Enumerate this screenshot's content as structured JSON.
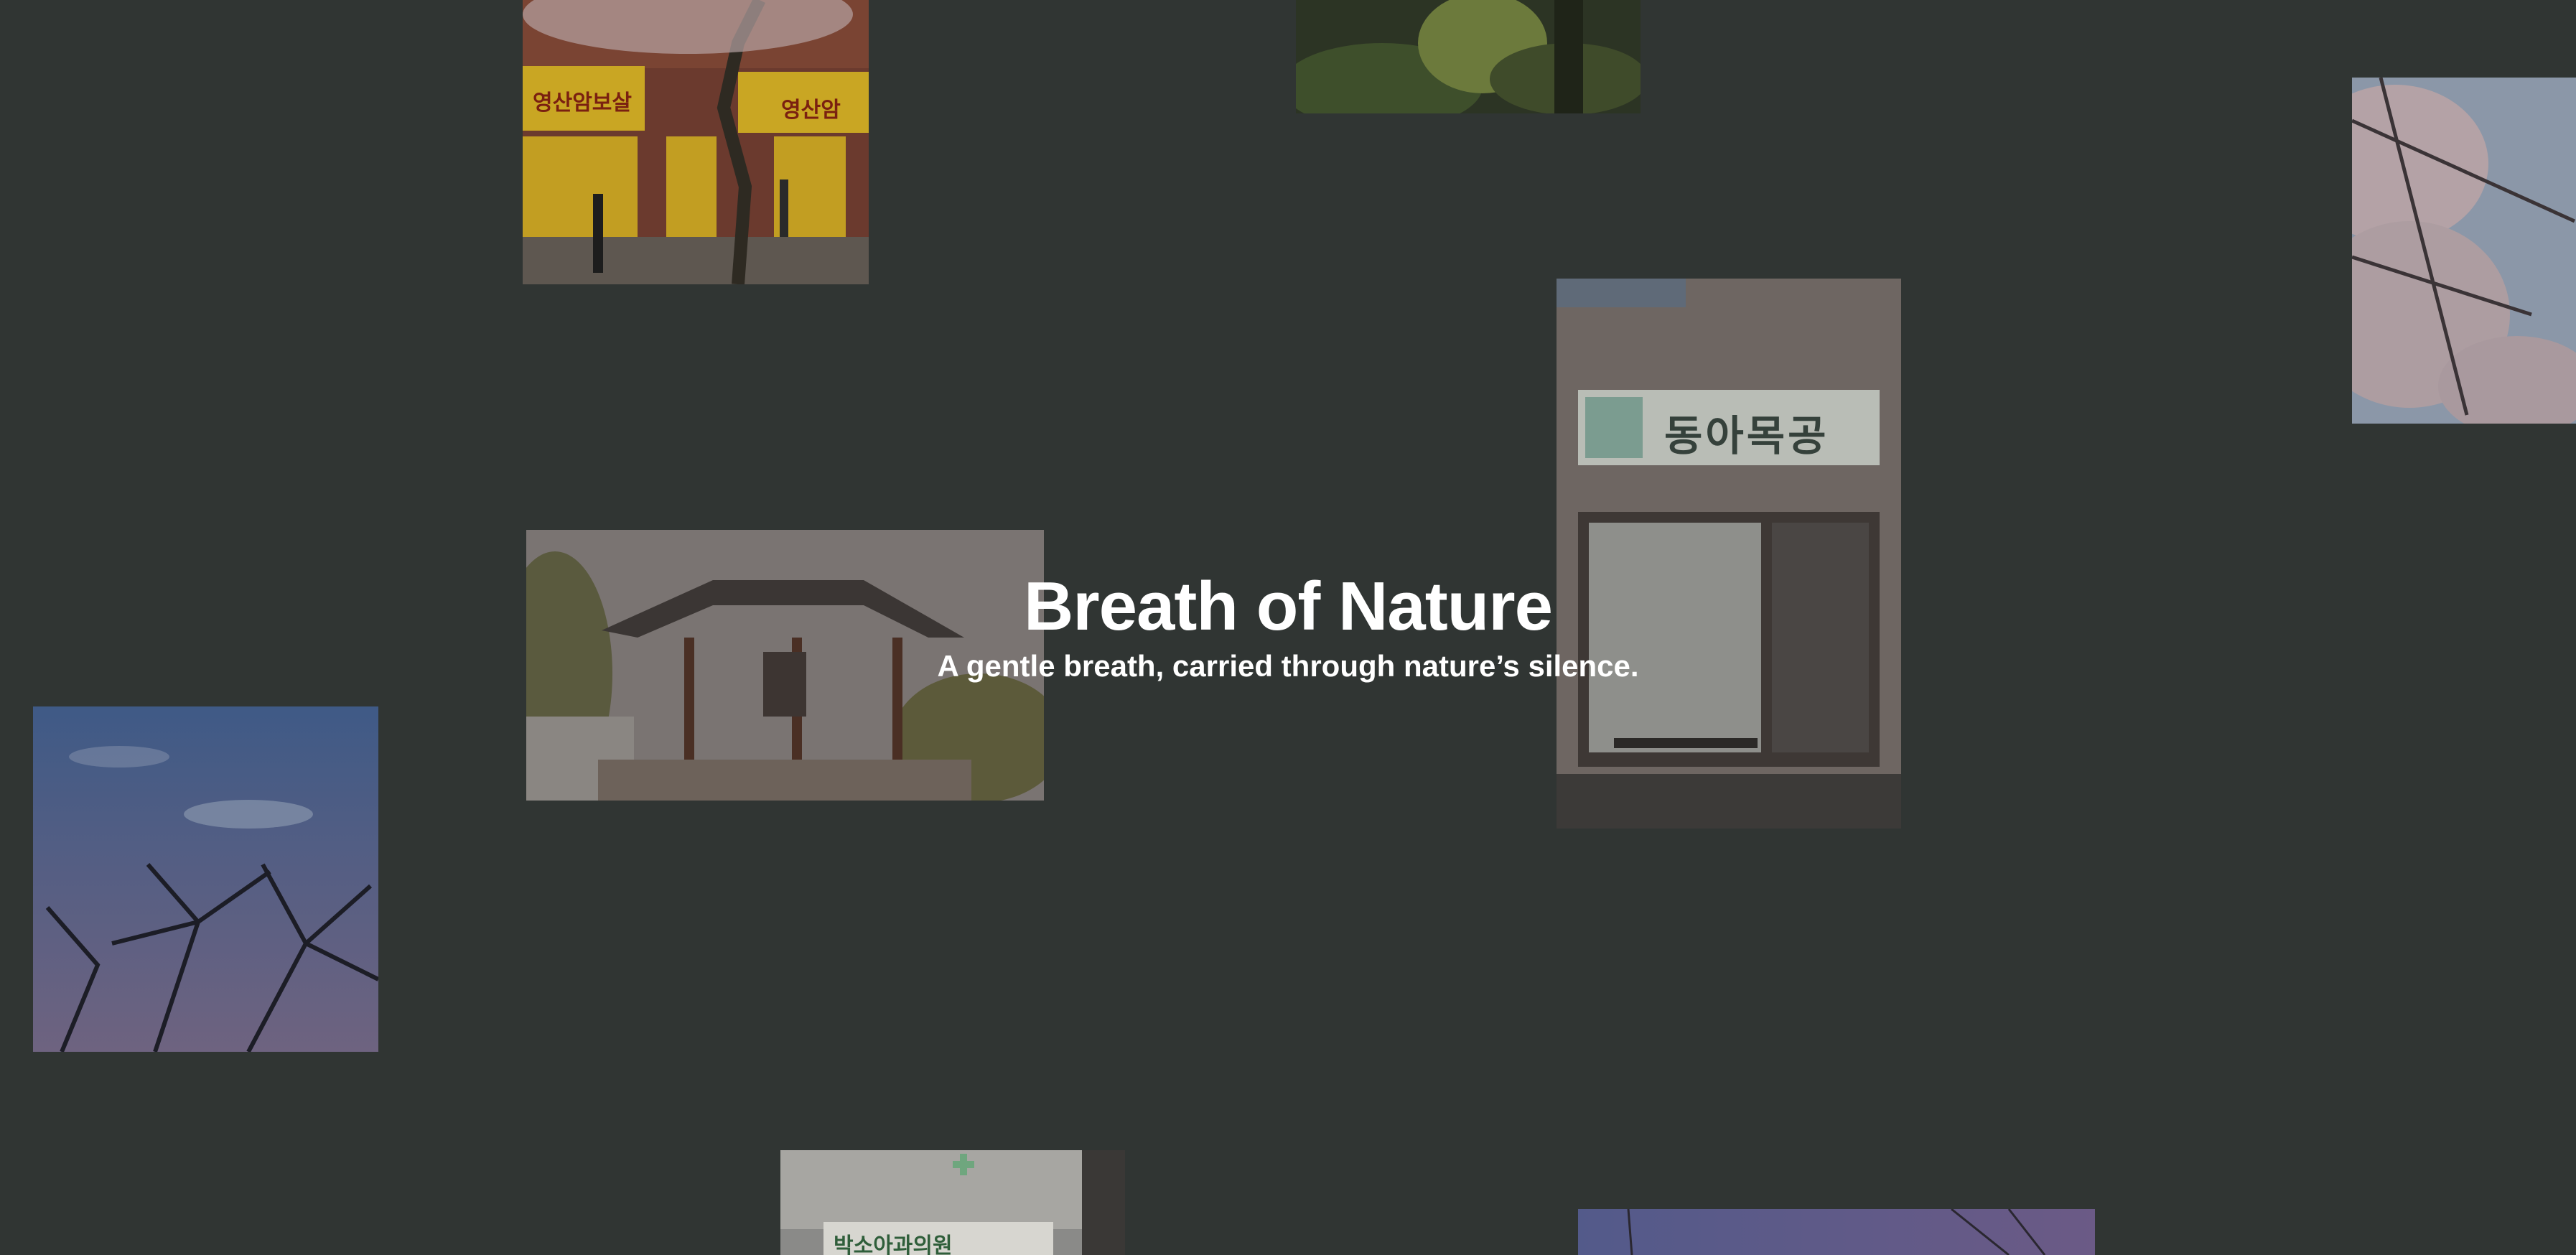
{
  "hero": {
    "title": "Breath of Nature",
    "subtitle": "A gentle breath, carried through nature’s silence."
  },
  "colors": {
    "background": "#303533",
    "text": "#ffffff"
  },
  "photos": [
    {
      "name": "photo-yellow-shop-cherry-tree",
      "sign_left": "영산암보살",
      "sign_right": "영산암"
    },
    {
      "name": "photo-forest-foliage"
    },
    {
      "name": "photo-cherry-blossom-sky"
    },
    {
      "name": "photo-storefront",
      "sign": "동아목공"
    },
    {
      "name": "photo-bell-pavilion"
    },
    {
      "name": "photo-sky-bare-trees"
    },
    {
      "name": "photo-clinic-building",
      "sign": "박소아과의원"
    },
    {
      "name": "photo-evening-sky-wires"
    }
  ]
}
